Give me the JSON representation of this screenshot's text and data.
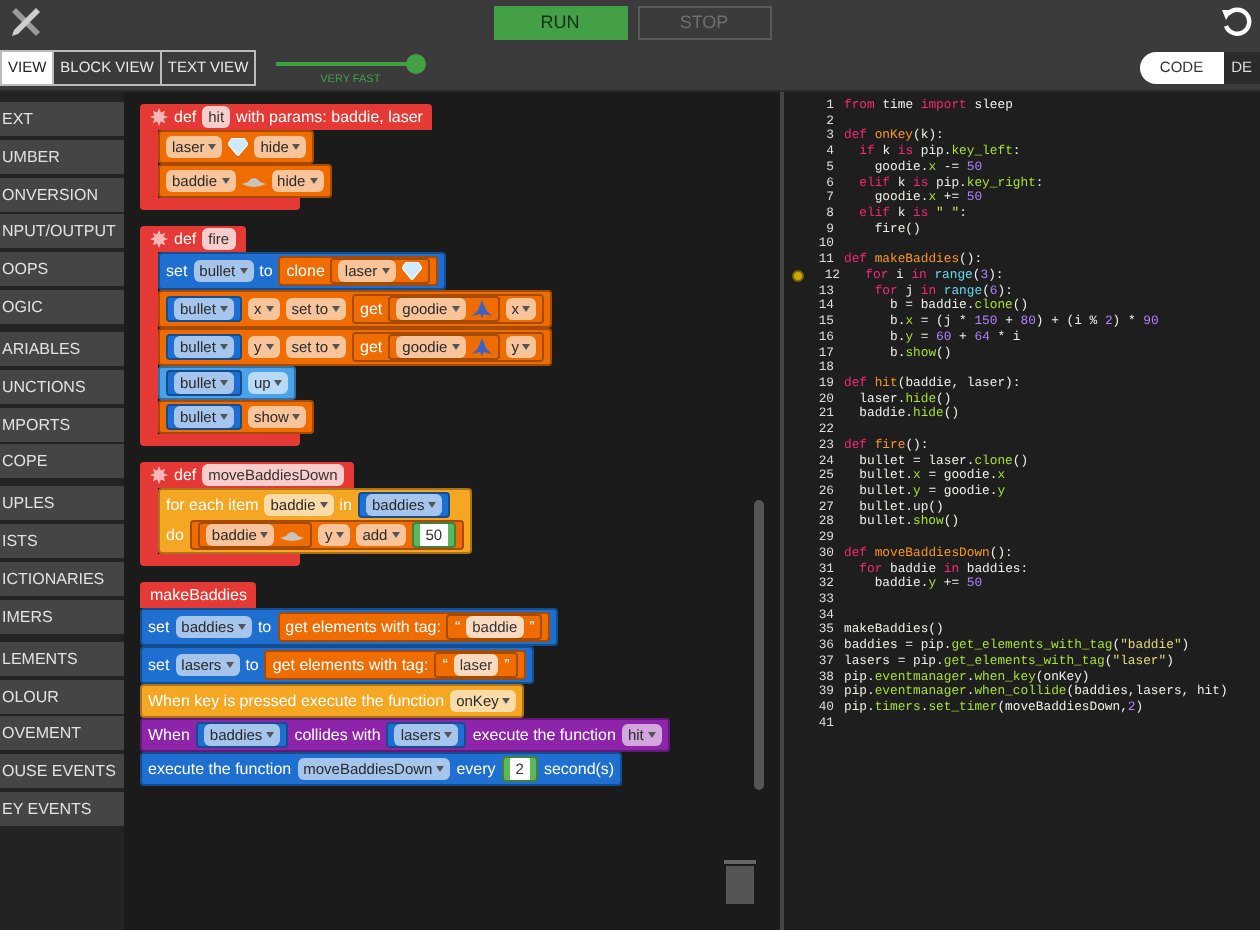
{
  "toolbar": {
    "buttons": [
      {
        "label": "RUN",
        "disabled": false
      },
      {
        "label": "STOP",
        "disabled": true
      }
    ]
  },
  "view_tabs": [
    {
      "label": "VIEW",
      "selected": true
    },
    {
      "label": "BLOCK VIEW",
      "selected": false
    },
    {
      "label": "TEXT VIEW",
      "selected": false
    }
  ],
  "speed": {
    "level": 0.95,
    "label": "VERY FAST"
  },
  "panel_toggle": [
    {
      "label": "CODE",
      "selected": true
    },
    {
      "label": "DE",
      "selected": false
    }
  ],
  "categories": [
    {
      "items": [
        "EXT",
        "UMBER",
        "ONVERSION",
        "NPUT/OUTPUT",
        "OOPS",
        "OGIC"
      ]
    },
    {
      "items": [
        "ARIABLES",
        "UNCTIONS",
        "MPORTS",
        "COPE"
      ]
    },
    {
      "items": [
        "UPLES",
        "ISTS",
        "ICTIONARIES",
        "IMERS"
      ]
    },
    {
      "items": [
        "LEMENTS",
        "OLOUR",
        "OVEMENT",
        "OUSE EVENTS",
        "EY EVENTS"
      ]
    }
  ],
  "workspace": {
    "stacks": [
      {
        "kind": "def",
        "color": "#e53935",
        "header": [
          {
            "kind": "cog"
          },
          {
            "kind": "text",
            "text": "def"
          },
          {
            "kind": "field",
            "text": "hit"
          },
          {
            "kind": "text",
            "text": "with params: baddie, laser"
          }
        ],
        "rows": [
          {
            "color": "#ef6c00",
            "segs": [
              {
                "kind": "drop",
                "text": "laser"
              },
              {
                "kind": "gem"
              },
              {
                "kind": "drop",
                "text": "hide"
              }
            ]
          },
          {
            "color": "#ef6c00",
            "segs": [
              {
                "kind": "drop",
                "text": "baddie"
              },
              {
                "kind": "ufo"
              },
              {
                "kind": "drop",
                "text": "hide"
              }
            ]
          }
        ]
      },
      {
        "kind": "def",
        "color": "#e53935",
        "header": [
          {
            "kind": "cog"
          },
          {
            "kind": "text",
            "text": "def"
          },
          {
            "kind": "field",
            "text": "fire"
          }
        ],
        "rows": [
          {
            "color": "#1e6fcf",
            "segs": [
              {
                "kind": "text",
                "text": "set"
              },
              {
                "kind": "drop",
                "text": "bullet"
              },
              {
                "kind": "text",
                "text": "to"
              },
              {
                "kind": "block",
                "color": "#ef6c00",
                "segs": [
                  {
                    "kind": "text",
                    "text": "clone"
                  },
                  {
                    "kind": "block",
                    "color": "#ef6c00",
                    "segs": [
                      {
                        "kind": "drop",
                        "text": "laser"
                      },
                      {
                        "kind": "gem"
                      }
                    ]
                  }
                ]
              }
            ]
          },
          {
            "color": "#ef6c00",
            "segs": [
              {
                "kind": "block",
                "color": "#1e6fcf",
                "segs": [
                  {
                    "kind": "drop",
                    "text": "bullet"
                  }
                ]
              },
              {
                "kind": "drop",
                "text": "x"
              },
              {
                "kind": "drop",
                "text": "set to"
              },
              {
                "kind": "block",
                "color": "#ef6c00",
                "segs": [
                  {
                    "kind": "text",
                    "text": "get"
                  },
                  {
                    "kind": "block",
                    "color": "#ef6c00",
                    "segs": [
                      {
                        "kind": "drop",
                        "text": "goodie"
                      },
                      {
                        "kind": "ship"
                      }
                    ]
                  },
                  {
                    "kind": "drop",
                    "text": "x"
                  }
                ]
              }
            ]
          },
          {
            "color": "#ef6c00",
            "segs": [
              {
                "kind": "block",
                "color": "#1e6fcf",
                "segs": [
                  {
                    "kind": "drop",
                    "text": "bullet"
                  }
                ]
              },
              {
                "kind": "drop",
                "text": "y"
              },
              {
                "kind": "drop",
                "text": "set to"
              },
              {
                "kind": "block",
                "color": "#ef6c00",
                "segs": [
                  {
                    "kind": "text",
                    "text": "get"
                  },
                  {
                    "kind": "block",
                    "color": "#ef6c00",
                    "segs": [
                      {
                        "kind": "drop",
                        "text": "goodie"
                      },
                      {
                        "kind": "ship"
                      }
                    ]
                  },
                  {
                    "kind": "drop",
                    "text": "y"
                  }
                ]
              }
            ]
          },
          {
            "color": "#4aa3ea",
            "segs": [
              {
                "kind": "block",
                "color": "#1e6fcf",
                "segs": [
                  {
                    "kind": "drop",
                    "text": "bullet"
                  }
                ]
              },
              {
                "kind": "drop",
                "text": "up"
              }
            ]
          },
          {
            "color": "#ef6c00",
            "segs": [
              {
                "kind": "block",
                "color": "#1e6fcf",
                "segs": [
                  {
                    "kind": "drop",
                    "text": "bullet"
                  }
                ]
              },
              {
                "kind": "drop",
                "text": "show"
              }
            ]
          }
        ]
      },
      {
        "kind": "def",
        "color": "#e53935",
        "header": [
          {
            "kind": "cog"
          },
          {
            "kind": "text",
            "text": "def"
          },
          {
            "kind": "field",
            "text": "moveBaddiesDown"
          }
        ],
        "rows": [
          {
            "color": "#f5a623",
            "segs": [
              {
                "kind": "text",
                "text": "for each item"
              },
              {
                "kind": "drop",
                "text": "baddie"
              },
              {
                "kind": "text",
                "text": "in"
              },
              {
                "kind": "block",
                "color": "#1e6fcf",
                "segs": [
                  {
                    "kind": "drop",
                    "text": "baddies"
                  }
                ]
              }
            ],
            "body": [
              {
                "kind": "text",
                "text": "do"
              },
              {
                "kind": "block",
                "color": "#ef6c00",
                "segs": [
                  {
                    "kind": "block",
                    "color": "#ef6c00",
                    "segs": [
                      {
                        "kind": "drop",
                        "text": "baddie"
                      },
                      {
                        "kind": "ufo"
                      }
                    ]
                  },
                  {
                    "kind": "drop",
                    "text": "y"
                  },
                  {
                    "kind": "drop",
                    "text": "add"
                  },
                  {
                    "kind": "block",
                    "color": "#5cb85c",
                    "segs": [
                      {
                        "kind": "num",
                        "text": "50"
                      }
                    ]
                  }
                ]
              }
            ]
          }
        ]
      },
      {
        "kind": "plain",
        "color": "#e53935",
        "header": [
          {
            "kind": "text",
            "text": "makeBaddies"
          }
        ],
        "rows": [
          {
            "color": "#1e6fcf",
            "segs": [
              {
                "kind": "text",
                "text": "set"
              },
              {
                "kind": "drop",
                "text": "baddies"
              },
              {
                "kind": "text",
                "text": "to"
              },
              {
                "kind": "block",
                "color": "#ef6c00",
                "segs": [
                  {
                    "kind": "text",
                    "text": "get elements with tag:"
                  },
                  {
                    "kind": "block",
                    "color": "#ef6c00",
                    "segs": [
                      {
                        "kind": "text",
                        "text": "“"
                      },
                      {
                        "kind": "field",
                        "text": "baddie"
                      },
                      {
                        "kind": "text",
                        "text": "”"
                      }
                    ]
                  }
                ]
              }
            ]
          },
          {
            "color": "#1e6fcf",
            "segs": [
              {
                "kind": "text",
                "text": "set"
              },
              {
                "kind": "drop",
                "text": "lasers"
              },
              {
                "kind": "text",
                "text": "to"
              },
              {
                "kind": "block",
                "color": "#ef6c00",
                "segs": [
                  {
                    "kind": "text",
                    "text": "get elements with tag:"
                  },
                  {
                    "kind": "block",
                    "color": "#ef6c00",
                    "segs": [
                      {
                        "kind": "text",
                        "text": "“"
                      },
                      {
                        "kind": "field",
                        "text": "laser"
                      },
                      {
                        "kind": "text",
                        "text": "”"
                      }
                    ]
                  }
                ]
              }
            ]
          },
          {
            "color": "#f5a623",
            "segs": [
              {
                "kind": "text",
                "text": "When key is pressed execute the function"
              },
              {
                "kind": "drop",
                "text": "onKey"
              }
            ]
          },
          {
            "color": "#8e24aa",
            "segs": [
              {
                "kind": "text",
                "text": "When"
              },
              {
                "kind": "block",
                "color": "#1e6fcf",
                "segs": [
                  {
                    "kind": "drop",
                    "text": "baddies"
                  }
                ]
              },
              {
                "kind": "text",
                "text": "collides with"
              },
              {
                "kind": "block",
                "color": "#1e6fcf",
                "segs": [
                  {
                    "kind": "drop",
                    "text": "lasers"
                  }
                ]
              },
              {
                "kind": "text",
                "text": "execute the function"
              },
              {
                "kind": "drop",
                "text": "hit"
              }
            ]
          },
          {
            "color": "#1e6fcf",
            "segs": [
              {
                "kind": "text",
                "text": "execute the function"
              },
              {
                "kind": "drop",
                "text": "moveBaddiesDown"
              },
              {
                "kind": "text",
                "text": "every"
              },
              {
                "kind": "block",
                "color": "#5cb85c",
                "segs": [
                  {
                    "kind": "num",
                    "text": "2"
                  }
                ]
              },
              {
                "kind": "text",
                "text": "second(s)"
              }
            ]
          }
        ]
      }
    ]
  },
  "editor": {
    "lines": [
      {
        "n": "1",
        "breakpoint": false,
        "tokens": [
          {
            "text": "from ",
            "kind": "kw"
          },
          {
            "text": "time "
          },
          {
            "text": "import ",
            "kind": "kw"
          },
          {
            "text": "sleep"
          }
        ]
      },
      {
        "n": "2",
        "breakpoint": false
      },
      {
        "n": "3",
        "breakpoint": false,
        "tokens": [
          {
            "text": "def ",
            "kind": "kw"
          },
          {
            "text": "onKey",
            "kind": "def"
          },
          {
            "text": "(k):"
          }
        ]
      },
      {
        "n": "4",
        "breakpoint": false,
        "tokens": [
          {
            "text": "  if ",
            "kind": "kw"
          },
          {
            "text": "k "
          },
          {
            "text": "is ",
            "kind": "kw"
          },
          {
            "text": "pip."
          },
          {
            "text": "key_left",
            "kind": "member"
          },
          {
            "text": ":"
          }
        ]
      },
      {
        "n": "5",
        "breakpoint": false,
        "tokens": [
          {
            "text": "    goodie."
          },
          {
            "text": "x",
            "kind": "member"
          },
          {
            "text": " -= "
          },
          {
            "text": "50",
            "kind": "num"
          }
        ]
      },
      {
        "n": "6",
        "breakpoint": false,
        "tokens": [
          {
            "text": "  elif ",
            "kind": "kw"
          },
          {
            "text": "k "
          },
          {
            "text": "is ",
            "kind": "kw"
          },
          {
            "text": "pip."
          },
          {
            "text": "key_right",
            "kind": "member"
          },
          {
            "text": ":"
          }
        ]
      },
      {
        "n": "7",
        "breakpoint": false,
        "tokens": [
          {
            "text": "    goodie."
          },
          {
            "text": "x",
            "kind": "member"
          },
          {
            "text": " += "
          },
          {
            "text": "50",
            "kind": "num"
          }
        ]
      },
      {
        "n": "8",
        "breakpoint": false,
        "tokens": [
          {
            "text": "  elif ",
            "kind": "kw"
          },
          {
            "text": "k "
          },
          {
            "text": "is ",
            "kind": "kw"
          },
          {
            "text": "\" \"",
            "kind": "str"
          },
          {
            "text": ":"
          }
        ]
      },
      {
        "n": "9",
        "breakpoint": false,
        "tokens": [
          {
            "text": "    fire()"
          }
        ]
      },
      {
        "n": "10",
        "breakpoint": false
      },
      {
        "n": "11",
        "breakpoint": false,
        "tokens": [
          {
            "text": "def ",
            "kind": "kw"
          },
          {
            "text": "makeBaddies",
            "kind": "def"
          },
          {
            "text": "():"
          }
        ]
      },
      {
        "n": "12",
        "breakpoint": true,
        "tokens": [
          {
            "text": "  for ",
            "kind": "kw"
          },
          {
            "text": "i "
          },
          {
            "text": "in ",
            "kind": "kw"
          },
          {
            "text": "range",
            "kind": "builtin"
          },
          {
            "text": "("
          },
          {
            "text": "3",
            "kind": "num"
          },
          {
            "text": "):"
          }
        ]
      },
      {
        "n": "13",
        "breakpoint": false,
        "tokens": [
          {
            "text": "    for ",
            "kind": "kw"
          },
          {
            "text": "j "
          },
          {
            "text": "in ",
            "kind": "kw"
          },
          {
            "text": "range",
            "kind": "builtin"
          },
          {
            "text": "("
          },
          {
            "text": "6",
            "kind": "num"
          },
          {
            "text": "):"
          }
        ]
      },
      {
        "n": "14",
        "breakpoint": false,
        "tokens": [
          {
            "text": "      b = baddie."
          },
          {
            "text": "clone",
            "kind": "member"
          },
          {
            "text": "()"
          }
        ]
      },
      {
        "n": "15",
        "breakpoint": false,
        "tokens": [
          {
            "text": "      b."
          },
          {
            "text": "x",
            "kind": "member"
          },
          {
            "text": " = (j * "
          },
          {
            "text": "150",
            "kind": "num"
          },
          {
            "text": " + "
          },
          {
            "text": "80",
            "kind": "num"
          },
          {
            "text": ") + (i % "
          },
          {
            "text": "2",
            "kind": "num"
          },
          {
            "text": ") * "
          },
          {
            "text": "90",
            "kind": "num"
          }
        ]
      },
      {
        "n": "16",
        "breakpoint": false,
        "tokens": [
          {
            "text": "      b."
          },
          {
            "text": "y",
            "kind": "member"
          },
          {
            "text": " = "
          },
          {
            "text": "60",
            "kind": "num"
          },
          {
            "text": " + "
          },
          {
            "text": "64",
            "kind": "num"
          },
          {
            "text": " * i"
          }
        ]
      },
      {
        "n": "17",
        "breakpoint": false,
        "tokens": [
          {
            "text": "      b."
          },
          {
            "text": "show",
            "kind": "member"
          },
          {
            "text": "()"
          }
        ]
      },
      {
        "n": "18",
        "breakpoint": false
      },
      {
        "n": "19",
        "breakpoint": false,
        "tokens": [
          {
            "text": "def ",
            "kind": "kw"
          },
          {
            "text": "hit",
            "kind": "def"
          },
          {
            "text": "(baddie, laser):"
          }
        ]
      },
      {
        "n": "20",
        "breakpoint": false,
        "tokens": [
          {
            "text": "  laser."
          },
          {
            "text": "hide",
            "kind": "member"
          },
          {
            "text": "()"
          }
        ]
      },
      {
        "n": "21",
        "breakpoint": false,
        "tokens": [
          {
            "text": "  baddie."
          },
          {
            "text": "hide",
            "kind": "member"
          },
          {
            "text": "()"
          }
        ]
      },
      {
        "n": "22",
        "breakpoint": false
      },
      {
        "n": "23",
        "breakpoint": false,
        "tokens": [
          {
            "text": "def ",
            "kind": "kw"
          },
          {
            "text": "fire",
            "kind": "def"
          },
          {
            "text": "():"
          }
        ]
      },
      {
        "n": "24",
        "breakpoint": false,
        "tokens": [
          {
            "text": "  bullet = laser."
          },
          {
            "text": "clone",
            "kind": "member"
          },
          {
            "text": "()"
          }
        ]
      },
      {
        "n": "25",
        "breakpoint": false,
        "tokens": [
          {
            "text": "  bullet."
          },
          {
            "text": "x",
            "kind": "member"
          },
          {
            "text": " = goodie."
          },
          {
            "text": "x",
            "kind": "member"
          }
        ]
      },
      {
        "n": "26",
        "breakpoint": false,
        "tokens": [
          {
            "text": "  bullet."
          },
          {
            "text": "y",
            "kind": "member"
          },
          {
            "text": " = goodie."
          },
          {
            "text": "y",
            "kind": "member"
          }
        ]
      },
      {
        "n": "27",
        "breakpoint": false,
        "tokens": [
          {
            "text": "  bullet.up()"
          }
        ]
      },
      {
        "n": "28",
        "breakpoint": false,
        "tokens": [
          {
            "text": "  bullet."
          },
          {
            "text": "show",
            "kind": "member"
          },
          {
            "text": "()"
          }
        ]
      },
      {
        "n": "29",
        "breakpoint": false
      },
      {
        "n": "30",
        "breakpoint": false,
        "tokens": [
          {
            "text": "def ",
            "kind": "kw"
          },
          {
            "text": "moveBaddiesDown",
            "kind": "def"
          },
          {
            "text": "():"
          }
        ]
      },
      {
        "n": "31",
        "breakpoint": false,
        "tokens": [
          {
            "text": "  for ",
            "kind": "kw"
          },
          {
            "text": "baddie "
          },
          {
            "text": "in ",
            "kind": "kw"
          },
          {
            "text": "baddies:"
          }
        ]
      },
      {
        "n": "32",
        "breakpoint": false,
        "tokens": [
          {
            "text": "    baddie."
          },
          {
            "text": "y",
            "kind": "member"
          },
          {
            "text": " += "
          },
          {
            "text": "50",
            "kind": "num"
          }
        ]
      },
      {
        "n": "33",
        "breakpoint": false
      },
      {
        "n": "34",
        "breakpoint": false
      },
      {
        "n": "35",
        "breakpoint": false,
        "tokens": [
          {
            "text": "makeBaddies()"
          }
        ]
      },
      {
        "n": "36",
        "breakpoint": false,
        "tokens": [
          {
            "text": "baddies = pip."
          },
          {
            "text": "get_elements_with_tag",
            "kind": "member"
          },
          {
            "text": "("
          },
          {
            "text": "\"baddie\"",
            "kind": "str"
          },
          {
            "text": ")"
          }
        ]
      },
      {
        "n": "37",
        "breakpoint": false,
        "tokens": [
          {
            "text": "lasers = pip."
          },
          {
            "text": "get_elements_with_tag",
            "kind": "member"
          },
          {
            "text": "("
          },
          {
            "text": "\"laser\"",
            "kind": "str"
          },
          {
            "text": ")"
          }
        ]
      },
      {
        "n": "38",
        "breakpoint": false,
        "tokens": [
          {
            "text": "pip."
          },
          {
            "text": "eventmanager",
            "kind": "member"
          },
          {
            "text": "."
          },
          {
            "text": "when_key",
            "kind": "member"
          },
          {
            "text": "(onKey)"
          }
        ]
      },
      {
        "n": "39",
        "breakpoint": false,
        "tokens": [
          {
            "text": "pip."
          },
          {
            "text": "eventmanager",
            "kind": "member"
          },
          {
            "text": "."
          },
          {
            "text": "when_collide",
            "kind": "member"
          },
          {
            "text": "(baddies,lasers, hit)"
          }
        ]
      },
      {
        "n": "40",
        "breakpoint": false,
        "tokens": [
          {
            "text": "pip."
          },
          {
            "text": "timers",
            "kind": "member"
          },
          {
            "text": "."
          },
          {
            "text": "set_timer",
            "kind": "member"
          },
          {
            "text": "(moveBaddiesDown,"
          },
          {
            "text": "2",
            "kind": "num"
          },
          {
            "text": ")"
          }
        ]
      },
      {
        "n": "41",
        "breakpoint": false
      }
    ]
  }
}
